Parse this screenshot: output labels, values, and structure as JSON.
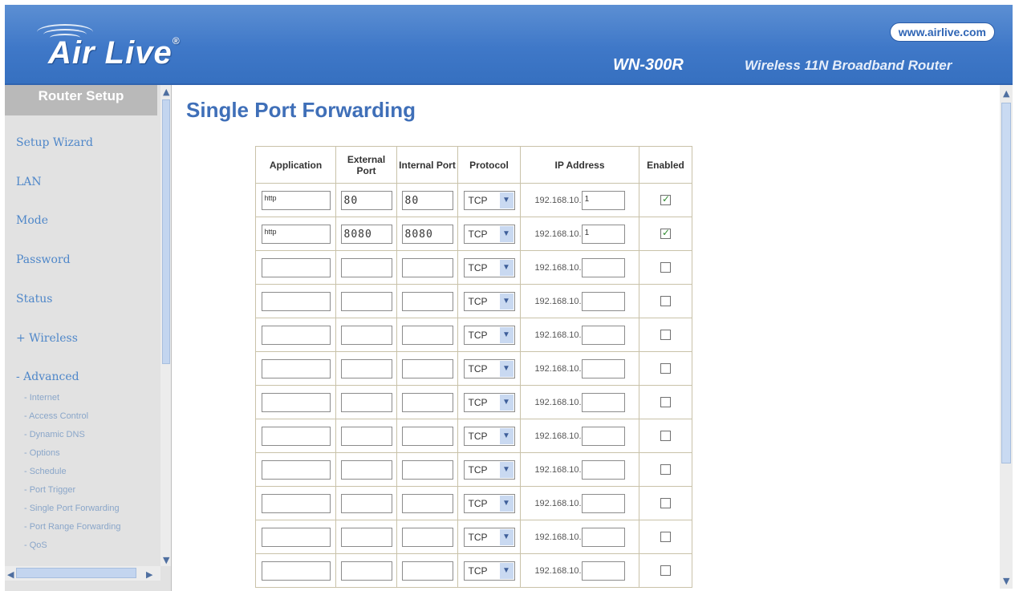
{
  "header": {
    "logo": "Air Live",
    "logo_mark": "®",
    "url": "www.airlive.com",
    "model": "WN-300R",
    "subtitle": "Wireless 11N Broadband Router"
  },
  "sidebar": {
    "title": "Router Setup",
    "items": [
      {
        "label": "Setup Wizard"
      },
      {
        "label": "LAN"
      },
      {
        "label": "Mode"
      },
      {
        "label": "Password"
      },
      {
        "label": "Status"
      },
      {
        "label": "+ Wireless"
      },
      {
        "label": "- Advanced"
      }
    ],
    "subitems": [
      {
        "label": "- Internet"
      },
      {
        "label": "- Access Control"
      },
      {
        "label": "- Dynamic DNS"
      },
      {
        "label": "- Options"
      },
      {
        "label": "- Schedule"
      },
      {
        "label": "- Port Trigger"
      },
      {
        "label": "- Single Port Forwarding"
      },
      {
        "label": "- Port Range Forwarding"
      },
      {
        "label": "- QoS"
      }
    ]
  },
  "page": {
    "title": "Single Port Forwarding"
  },
  "table": {
    "headers": {
      "application": "Application",
      "external_port": "External Port",
      "internal_port": "Internal Port",
      "protocol": "Protocol",
      "ip_address": "IP Address",
      "enabled": "Enabled"
    },
    "ip_prefix": "192.168.10.",
    "rows": [
      {
        "app": "http",
        "ext": "80",
        "int": "80",
        "proto": "TCP",
        "ip": "1",
        "enabled": true
      },
      {
        "app": "http",
        "ext": "8080",
        "int": "8080",
        "proto": "TCP",
        "ip": "1",
        "enabled": true
      },
      {
        "app": "",
        "ext": "",
        "int": "",
        "proto": "TCP",
        "ip": "",
        "enabled": false
      },
      {
        "app": "",
        "ext": "",
        "int": "",
        "proto": "TCP",
        "ip": "",
        "enabled": false
      },
      {
        "app": "",
        "ext": "",
        "int": "",
        "proto": "TCP",
        "ip": "",
        "enabled": false
      },
      {
        "app": "",
        "ext": "",
        "int": "",
        "proto": "TCP",
        "ip": "",
        "enabled": false
      },
      {
        "app": "",
        "ext": "",
        "int": "",
        "proto": "TCP",
        "ip": "",
        "enabled": false
      },
      {
        "app": "",
        "ext": "",
        "int": "",
        "proto": "TCP",
        "ip": "",
        "enabled": false
      },
      {
        "app": "",
        "ext": "",
        "int": "",
        "proto": "TCP",
        "ip": "",
        "enabled": false
      },
      {
        "app": "",
        "ext": "",
        "int": "",
        "proto": "TCP",
        "ip": "",
        "enabled": false
      },
      {
        "app": "",
        "ext": "",
        "int": "",
        "proto": "TCP",
        "ip": "",
        "enabled": false
      },
      {
        "app": "",
        "ext": "",
        "int": "",
        "proto": "TCP",
        "ip": "",
        "enabled": false
      }
    ]
  },
  "colors": {
    "header_blue": "#3f78c8",
    "title_blue": "#3f6fb8",
    "nav_blue": "#4f87c9"
  },
  "icons": {
    "scroll_up": "scroll-up-icon",
    "scroll_down": "scroll-down-icon",
    "dropdown": "chevron-down-icon",
    "check": "check-icon"
  }
}
